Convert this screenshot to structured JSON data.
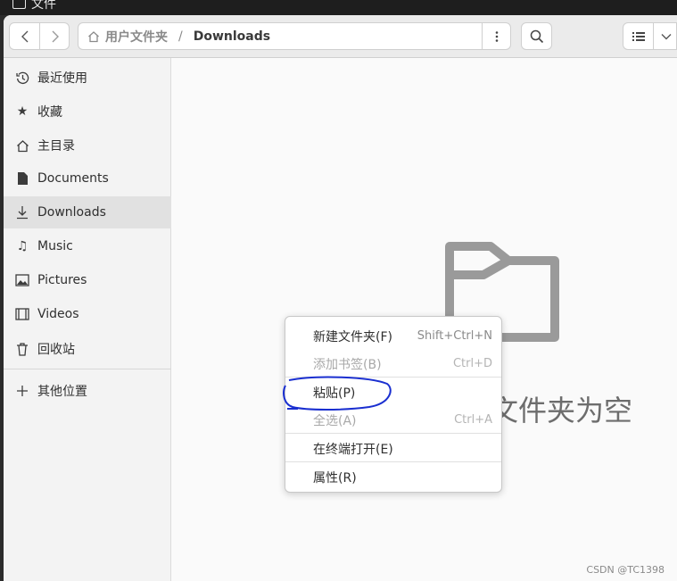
{
  "top_panel": {
    "app_name": "文件"
  },
  "headerbar": {
    "back_icon": "chevron-left-icon",
    "forward_icon": "chevron-right-icon",
    "path": {
      "home": "用户文件夹",
      "separator": "/",
      "current": "Downloads"
    },
    "path_menu_icon": "vertical-dots-icon",
    "search_icon": "search-icon",
    "view_icon": "list-view-icon",
    "view_dropdown_icon": "chevron-down-icon"
  },
  "sidebar": {
    "items": [
      {
        "label": "最近使用",
        "icon": "clock-icon"
      },
      {
        "label": "收藏",
        "icon": "star-icon"
      },
      {
        "label": "主目录",
        "icon": "home-icon"
      },
      {
        "label": "Documents",
        "icon": "document-icon"
      },
      {
        "label": "Downloads",
        "icon": "download-icon",
        "active": true
      },
      {
        "label": "Music",
        "icon": "music-note-icon"
      },
      {
        "label": "Pictures",
        "icon": "picture-icon"
      },
      {
        "label": "Videos",
        "icon": "film-icon"
      },
      {
        "label": "回收站",
        "icon": "trash-icon"
      },
      {
        "label": "其他位置",
        "icon": "plus-icon"
      }
    ]
  },
  "content": {
    "empty_message": "文件夹为空",
    "watermark": "CSDN @TC1398"
  },
  "context_menu": {
    "items": [
      {
        "label": "新建文件夹(F)",
        "shortcut": "Shift+Ctrl+N",
        "enabled": true
      },
      {
        "label": "添加书签(B)",
        "shortcut": "Ctrl+D",
        "enabled": false
      },
      {
        "label": "粘贴(P)",
        "shortcut": "",
        "enabled": true
      },
      {
        "label": "全选(A)",
        "shortcut": "Ctrl+A",
        "enabled": false
      },
      {
        "label": "在终端打开(E)",
        "shortcut": "",
        "enabled": true
      },
      {
        "label": "属性(R)",
        "shortcut": "",
        "enabled": true
      }
    ]
  },
  "colors": {
    "annotation": "#1a2fd0",
    "accent_active": "#e1e1e1"
  }
}
